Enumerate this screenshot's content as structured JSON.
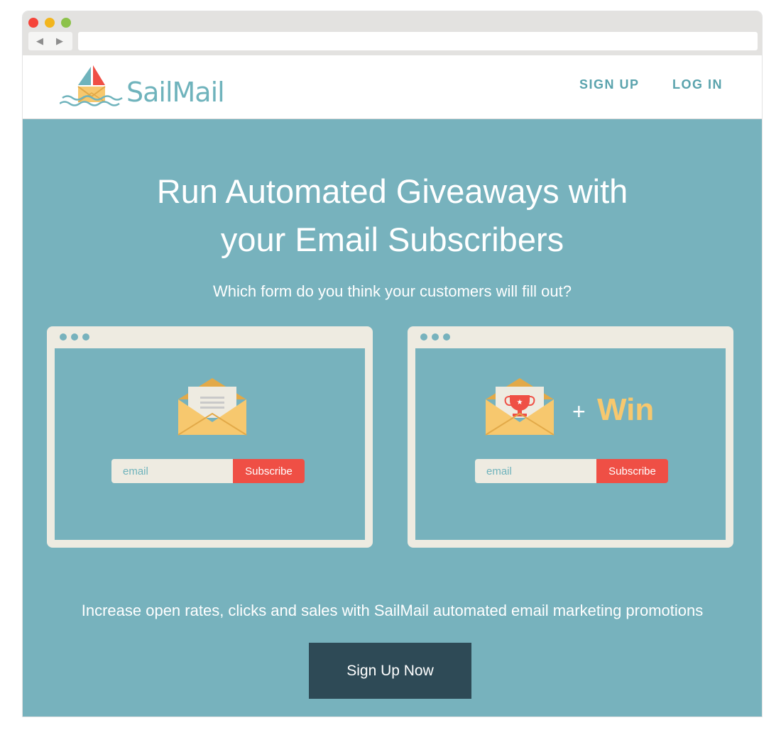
{
  "brand": {
    "name": "SailMail"
  },
  "nav": {
    "signup_label": "SIGN UP",
    "login_label": "LOG IN"
  },
  "hero": {
    "headline_line1": "Run Automated Giveaways with",
    "headline_line2": "your Email Subscribers",
    "question": "Which form do you think your customers will fill out?",
    "tagline": "Increase open rates, clicks and sales with SailMail automated email marketing promotions",
    "cta_label": "Sign Up Now"
  },
  "forms": {
    "left": {
      "placeholder": "email",
      "button_label": "Subscribe"
    },
    "right": {
      "placeholder": "email",
      "button_label": "Subscribe",
      "plus_symbol": "+",
      "win_label": "Win"
    }
  },
  "colors": {
    "hero_bg": "#77b2bd",
    "brand_teal": "#6fb3bc",
    "subscribe_red": "#ef4f45",
    "cta_dark": "#2e4a56",
    "win_yellow": "#f7c86e",
    "frame_cream": "#eeebe1"
  },
  "icons": [
    "back-arrow-icon",
    "forward-arrow-icon",
    "sailboat-logo-icon",
    "envelope-letter-icon",
    "envelope-trophy-icon"
  ]
}
